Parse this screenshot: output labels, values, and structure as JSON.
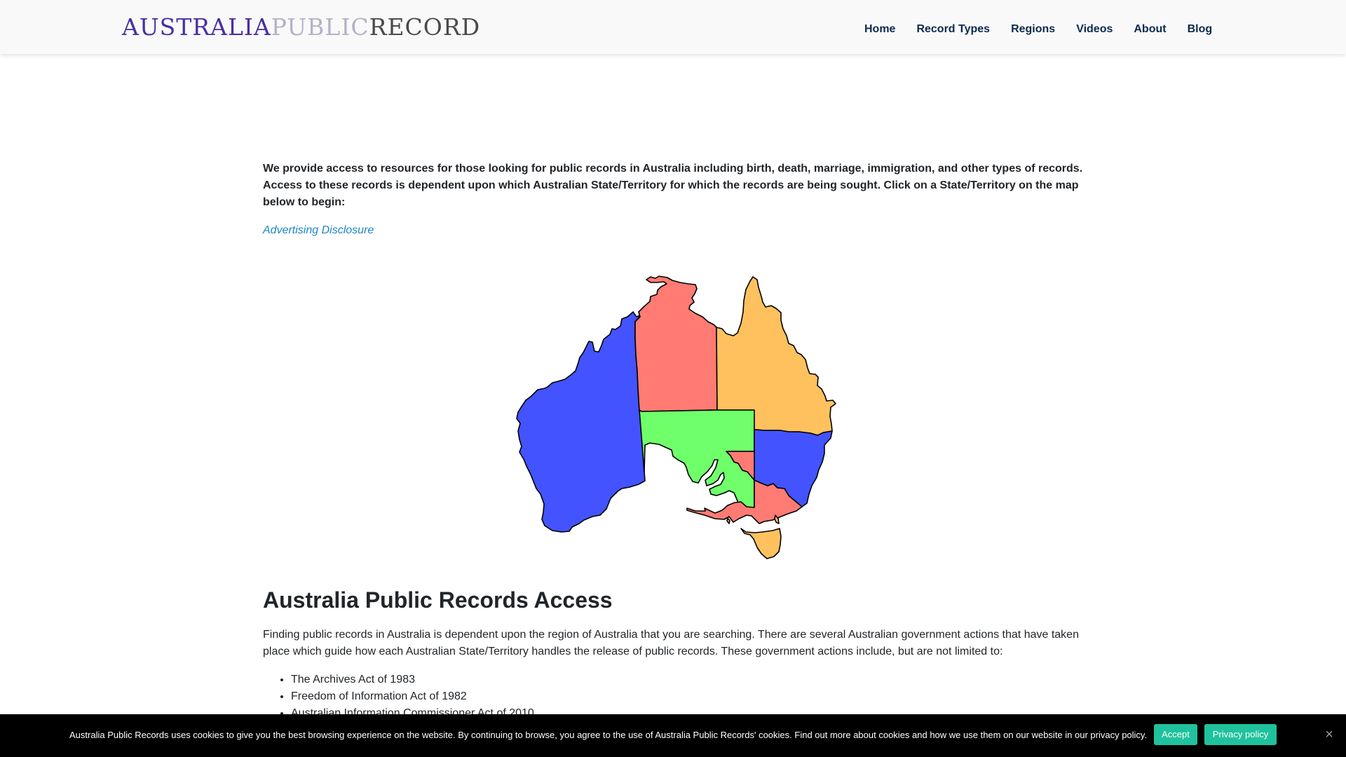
{
  "header": {
    "logo": {
      "part1": "AUSTRALIA",
      "part2": "PUBLIC",
      "part3": "RECORD"
    },
    "nav": [
      "Home",
      "Record Types",
      "Regions",
      "Videos",
      "About",
      "Blog"
    ]
  },
  "intro": {
    "text": "We provide access to resources for those looking for public records in Australia including birth, death, marriage, immigration, and other types of records. Access to these records is dependent upon which Australian State/Territory for which the records are being sought. Click on a State/Territory on the map below to begin:",
    "disclosure_link": "Advertising Disclosure"
  },
  "map": {
    "states": [
      {
        "name": "Western Australia",
        "color": "#4353ff"
      },
      {
        "name": "Northern Territory",
        "color": "#ff7b74"
      },
      {
        "name": "Queensland",
        "color": "#ffc15e"
      },
      {
        "name": "South Australia",
        "color": "#6fff6a"
      },
      {
        "name": "New South Wales",
        "color": "#4353ff"
      },
      {
        "name": "Victoria",
        "color": "#ff7b74"
      },
      {
        "name": "Tasmania",
        "color": "#ffc15e"
      }
    ]
  },
  "section": {
    "heading": "Australia Public Records Access",
    "paragraph": "Finding public records in Australia is dependent upon the region of Australia that you are searching. There are several Australian government actions that have taken place which guide how each Australian State/Territory handles the release of public records. These government actions include, but are not limited to:",
    "acts": [
      "The Archives Act of 1983",
      "Freedom of Information Act of 1982",
      "Australian Information Commissioner Act of 2010"
    ]
  },
  "cookie_banner": {
    "text": "Australia Public Records uses cookies to give you the best browsing experience on the website. By continuing to browse, you agree to the use of Australia Public Records' cookies. Find out more about cookies and how we use them on our website in our privacy policy.",
    "accept_label": "Accept",
    "privacy_label": "Privacy policy",
    "close_icon": "×"
  }
}
